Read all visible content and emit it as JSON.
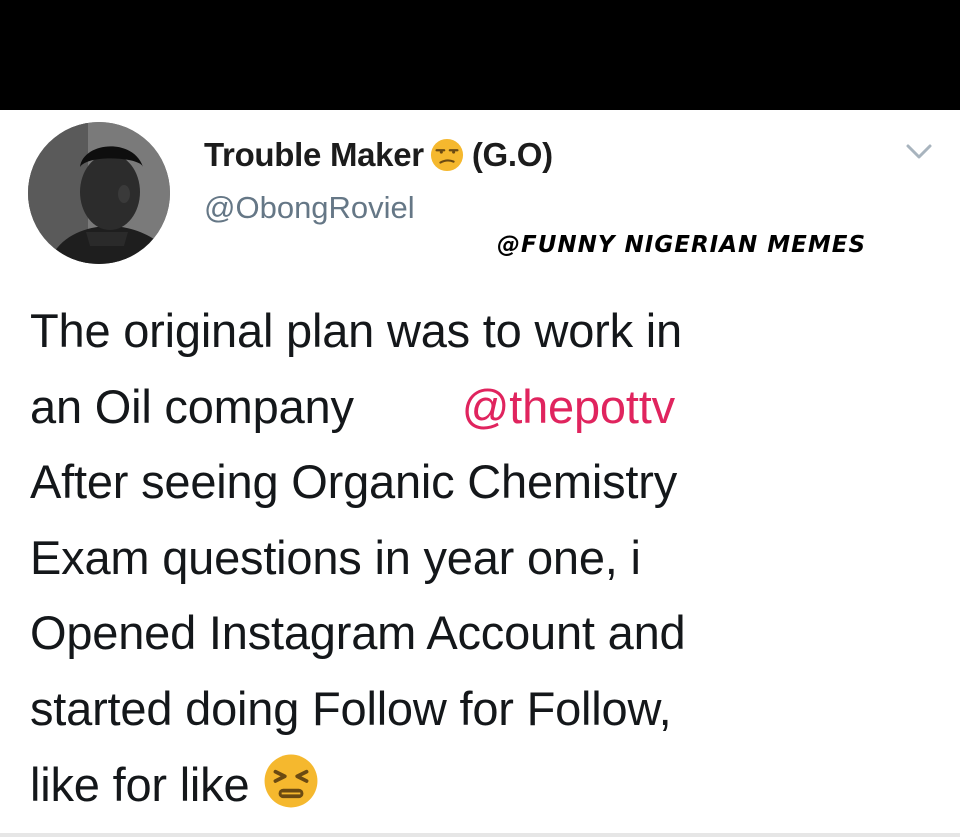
{
  "tweet": {
    "display_name": "Trouble Maker",
    "display_name_suffix": "(G.O)",
    "handle": "@ObongRoviel",
    "watermark": "@FUNNY NIGERIAN MEMES",
    "text_lines": [
      "The original plan was to work in",
      "an Oil company",
      "After seeing Organic Chemistry",
      "Exam questions in year one, i",
      "Opened Instagram Account and",
      "started doing Follow for Follow,",
      "like for like"
    ],
    "mention": "@thepottv"
  },
  "icons": {
    "name_emoji": "unamused-face-icon",
    "text_emoji": "persevering-face-icon",
    "menu": "chevron-down-icon"
  },
  "colors": {
    "mention": "#e0245e",
    "handle": "#657786",
    "emoji": "#f5b82e"
  }
}
